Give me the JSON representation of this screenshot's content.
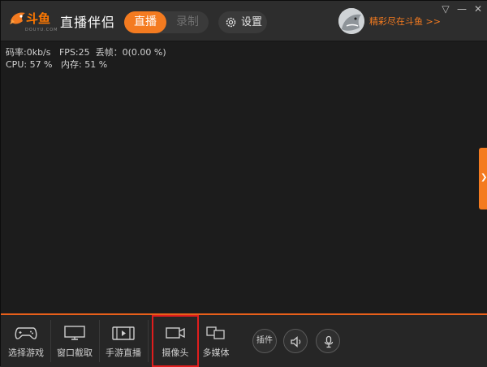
{
  "brand": {
    "logo_text": "斗鱼",
    "logo_sub": "DOUYU.COM",
    "app_title": "直播伴侣"
  },
  "modes": {
    "live": "直播",
    "record": "录制",
    "active": "live"
  },
  "settings": {
    "label": "设置"
  },
  "user": {
    "link_text": "精彩尽在斗鱼 >>"
  },
  "window_controls": {
    "menu": "▽",
    "minimize": "—",
    "close": "✕"
  },
  "stats": {
    "line1": "码率:0kb/s   FPS:25  丢帧：0(0.00 %)",
    "line2": "CPU: 57 %   内存: 51 %"
  },
  "side_tab": {
    "arrow": "❯"
  },
  "toolbar": {
    "items": [
      {
        "label": "选择游戏",
        "icon": "gamepad-icon"
      },
      {
        "label": "窗口截取",
        "icon": "monitor-icon"
      },
      {
        "label": "手游直播",
        "icon": "tablet-play-icon"
      },
      {
        "label": "摄像头",
        "icon": "camera-icon",
        "selected": true
      },
      {
        "label": "多媒体",
        "icon": "multimedia-icon"
      }
    ],
    "plugin_label": "插件",
    "speaker_icon": "speaker-icon",
    "mic_icon": "microphone-icon"
  },
  "colors": {
    "accent": "#f47b20",
    "selection": "#e01d1d",
    "background": "#1c1c1c"
  }
}
